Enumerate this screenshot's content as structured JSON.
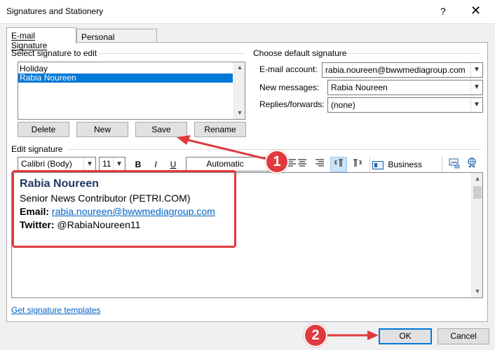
{
  "window": {
    "title": "Signatures and Stationery",
    "help": "?",
    "close": "✕"
  },
  "tabs": [
    {
      "label": "E-mail Signature",
      "active": true
    },
    {
      "label": "Personal Stationery",
      "active": false
    }
  ],
  "select_signature": {
    "label": "Select signature to edit",
    "items": [
      "Holiday",
      "Rabia Noureen"
    ],
    "selected": "Rabia Noureen",
    "buttons": {
      "delete": "Delete",
      "new": "New",
      "save": "Save",
      "rename": "Rename"
    }
  },
  "default_signature": {
    "label": "Choose default signature",
    "email_account_label": "E-mail account:",
    "email_account_value": "rabia.noureen@bwwmediagroup.com",
    "new_messages_label": "New messages:",
    "new_messages_value": "Rabia Noureen",
    "replies_label": "Replies/forwards:",
    "replies_value": "(none)"
  },
  "edit_signature": {
    "label": "Edit signature",
    "font": "Calibri (Body)",
    "size": "11",
    "bold": "B",
    "italic": "I",
    "underline": "U",
    "color": "Automatic",
    "business_card": "Business Card"
  },
  "signature": {
    "name": "Rabia Noureen",
    "role": "Senior News Contributor (PETRI.COM)",
    "email_label": "Email:",
    "email": "rabia.noureen@bwwmediagroup.com",
    "twitter_label": "Twitter:",
    "twitter": "@RabiaNoureen11"
  },
  "footer": {
    "templates_link": "Get signature templates",
    "ok": "OK",
    "cancel": "Cancel"
  },
  "annotations": {
    "badge1": "1",
    "badge2": "2",
    "accent": "#e03a3e"
  }
}
